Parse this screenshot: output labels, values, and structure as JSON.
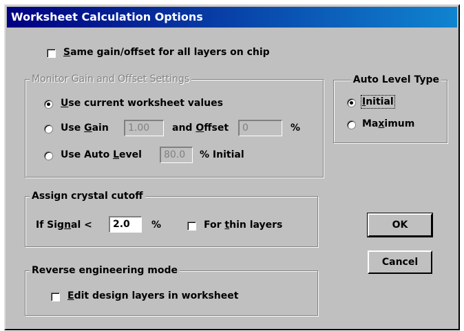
{
  "window": {
    "title": "Worksheet Calculation Options"
  },
  "same_gain": {
    "checked": false,
    "label_mnemonic": "S",
    "label_rest": "ame gain/offset for all layers on chip"
  },
  "monitor_group": {
    "legend": "Monitor Gain and Offset Settings",
    "option_current": {
      "mnemonic": "U",
      "rest": "se current worksheet values",
      "selected": true
    },
    "option_gain": {
      "pre": "Use ",
      "mnemonic": "G",
      "rest": "ain",
      "gain_value": "1.00",
      "and_pre": "and ",
      "offset_mnemonic": "O",
      "offset_rest": "ffset",
      "offset_value": "0",
      "unit": "%"
    },
    "option_auto": {
      "pre": "Use Auto ",
      "mnemonic": "L",
      "rest": "evel",
      "value": "80.0",
      "suffix": "% Initial"
    }
  },
  "auto_level_group": {
    "legend": "Auto Level Type",
    "initial": {
      "mnemonic": "I",
      "rest": "nitial",
      "selected": true
    },
    "maximum": {
      "pre": "Ma",
      "mnemonic": "x",
      "rest": "imum",
      "selected": false
    }
  },
  "cutoff_group": {
    "legend": "Assign crystal cutoff",
    "signal": {
      "pre": "If Sig",
      "mnemonic": "n",
      "rest": "al <",
      "value": "2.0",
      "unit": "%"
    },
    "thin": {
      "pre": "For ",
      "mnemonic": "t",
      "rest": "hin layers",
      "checked": false
    }
  },
  "reverse_group": {
    "legend": "Reverse engineering mode",
    "edit": {
      "mnemonic": "E",
      "rest": "dit design layers in worksheet",
      "checked": false
    }
  },
  "buttons": {
    "ok": "OK",
    "cancel": "Cancel"
  }
}
